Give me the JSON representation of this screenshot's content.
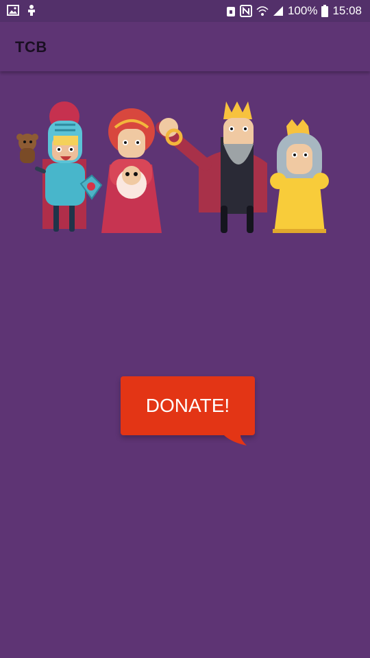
{
  "status_bar": {
    "battery": "100%",
    "time": "15:08",
    "icons": [
      "image-icon",
      "android-debug-icon",
      "nfc-lock-icon",
      "nfc-icon",
      "wifi-icon",
      "signal-icon",
      "battery-icon"
    ]
  },
  "app_bar": {
    "title": "TCB"
  },
  "illustration": {
    "characters": [
      "knight",
      "lady-with-baby",
      "king",
      "queen"
    ]
  },
  "donate": {
    "label": "DONATE!"
  },
  "colors": {
    "background": "#5E3474",
    "donate": "#E33515"
  }
}
